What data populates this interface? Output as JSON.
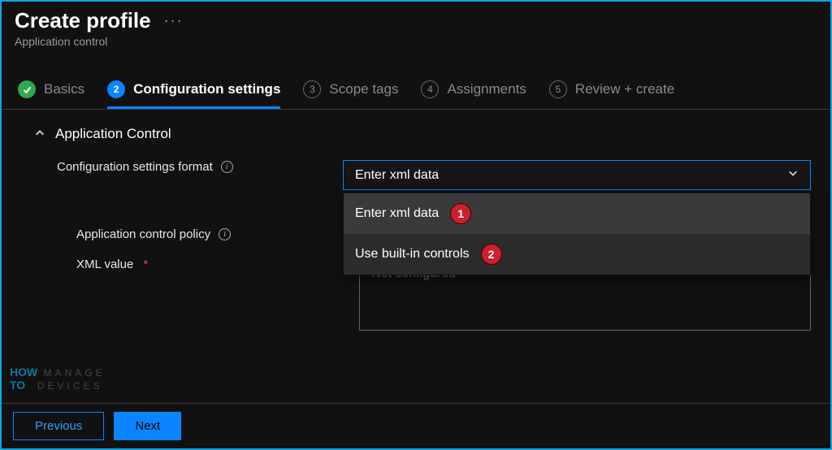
{
  "header": {
    "title": "Create profile",
    "subtitle": "Application control"
  },
  "tabs": [
    {
      "num": "",
      "label": "Basics",
      "state": "done"
    },
    {
      "num": "2",
      "label": "Configuration settings",
      "state": "active"
    },
    {
      "num": "3",
      "label": "Scope tags",
      "state": "pending"
    },
    {
      "num": "4",
      "label": "Assignments",
      "state": "pending"
    },
    {
      "num": "5",
      "label": "Review + create",
      "state": "pending"
    }
  ],
  "section": {
    "title": "Application Control",
    "fields": {
      "format_label": "Configuration settings format",
      "format_value": "Enter xml data",
      "format_options": [
        {
          "label": "Enter xml data",
          "annotation": "1"
        },
        {
          "label": "Use built-in controls",
          "annotation": "2"
        }
      ],
      "policy_label": "Application control policy",
      "xml_label": "XML value",
      "xml_required": "*",
      "xml_placeholder": "Not configured"
    }
  },
  "footer": {
    "prev": "Previous",
    "next": "Next"
  },
  "watermark": {
    "line1_a": "HOW",
    "line1_b": "MANAGE",
    "line2_a": "TO",
    "line2_b": "DEVICES"
  }
}
